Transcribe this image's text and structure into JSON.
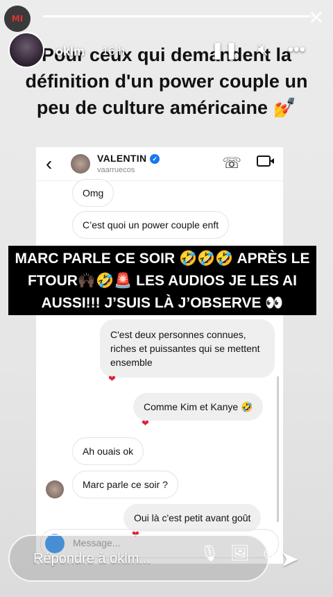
{
  "story": {
    "username": "oklm",
    "time": "16 h",
    "progress_fraction": 0.98,
    "segments": 1
  },
  "icons": {
    "pause": "pause-icon",
    "mute": "mute-icon",
    "more": "more-icon",
    "close": "close-icon"
  },
  "caption": "Pour ceux qui demandent la définition d'un power couple un peu de culture américaine 💅",
  "chat": {
    "name": "VALENTIN",
    "handle": "vaarruecos",
    "messages": [
      {
        "text": "Omg",
        "from": "them"
      },
      {
        "text": "C’est quoi un power couple enft",
        "from": "them"
      },
      {
        "text": "C'est deux personnes connues, riches et puissantes qui se mettent ensemble",
        "from": "me",
        "heart": true
      },
      {
        "text": "Comme Kim et Kanye 🤣",
        "from": "me",
        "heart": true
      },
      {
        "text": "Ah ouais ok",
        "from": "them"
      },
      {
        "text": "Marc parle ce soir ?",
        "from": "them"
      },
      {
        "text": "Oui là c'est petit avant goût",
        "from": "me",
        "heart": true
      }
    ],
    "message_placeholder": "Message..."
  },
  "banner": "MARC PARLE CE SOIR 🤣🤣🤣 APRÈS LE FTOUR🙌🏿🤣🚨 LES AUDIOS JE LES AI AUSSI!!! J’SUIS LÀ J’OBSERVE 👀",
  "reply": {
    "placeholder": "Répondre à oklm..."
  },
  "colors": {
    "heart": "#e0233b",
    "verified": "#1877f2"
  }
}
